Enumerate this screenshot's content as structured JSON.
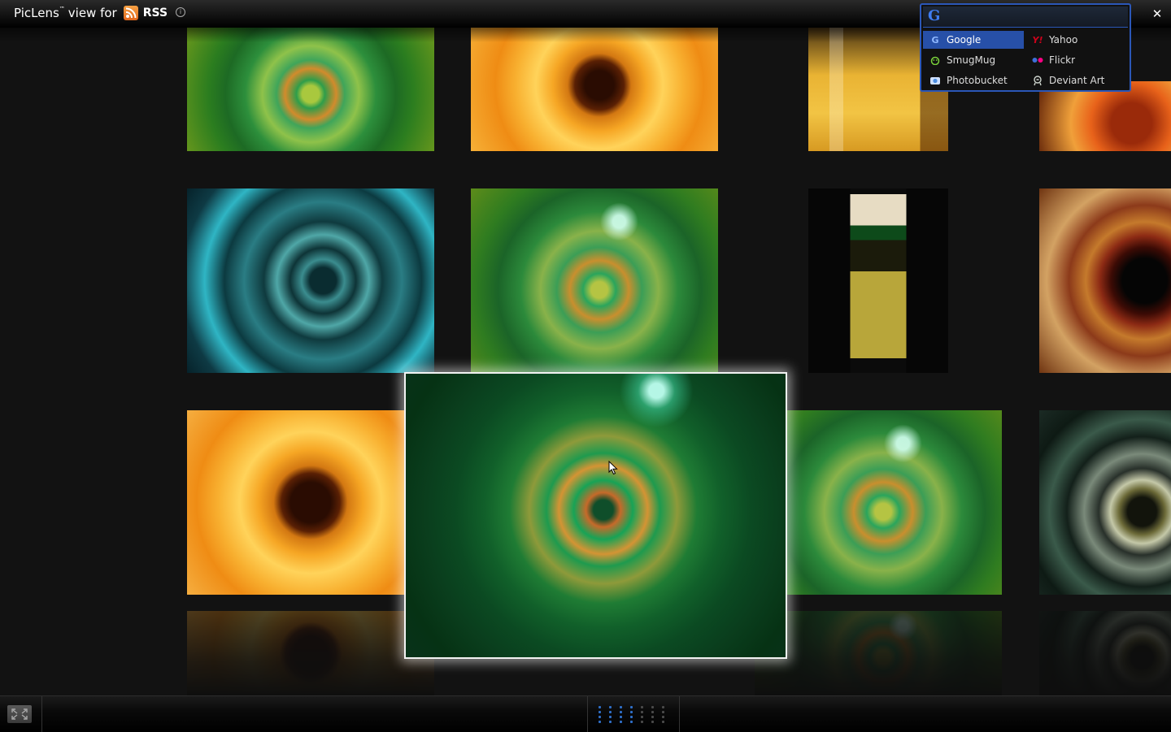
{
  "header": {
    "brand": "PicLens",
    "trademark": "™",
    "view_for": "view for",
    "feed_label": "RSS",
    "close_symbol": "✕",
    "info_symbol": "i"
  },
  "search": {
    "logo": "G",
    "engines": [
      {
        "label": "Google",
        "icon": "google-icon",
        "color": "#3f7df2",
        "active": true
      },
      {
        "label": "Yahoo",
        "icon": "yahoo-icon",
        "color": "#d0021b",
        "active": false
      },
      {
        "label": "SmugMug",
        "icon": "smugmug-icon",
        "color": "#7ad13a",
        "active": false
      },
      {
        "label": "Flickr",
        "icon": "flickr-icon",
        "color": "#ff0084",
        "active": false
      },
      {
        "label": "Photobucket",
        "icon": "photobucket-icon",
        "color": "#4a8de0",
        "active": false
      },
      {
        "label": "Deviant Art",
        "icon": "deviantart-icon",
        "color": "#cfd6cf",
        "active": false
      }
    ]
  },
  "colors": {
    "accent": "#2b57b8",
    "background": "#121212",
    "rss": "#e2661b"
  },
  "pager": {
    "active_dots": 16,
    "inactive_dots": 12
  }
}
